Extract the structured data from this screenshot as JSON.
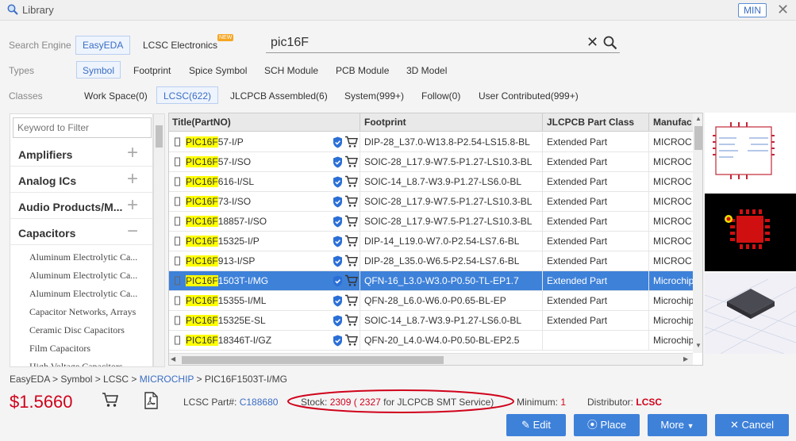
{
  "window": {
    "title": "Library",
    "min_label": "MIN"
  },
  "search_engine": {
    "label": "Search Engine",
    "options": [
      "EasyEDA",
      "LCSC Electronics"
    ],
    "new_badge": "NEW"
  },
  "search": {
    "value": "pic16F"
  },
  "types": {
    "label": "Types",
    "options": [
      "Symbol",
      "Footprint",
      "Spice Symbol",
      "SCH Module",
      "PCB Module",
      "3D Model"
    ]
  },
  "classes": {
    "label": "Classes",
    "options": [
      "Work Space(0)",
      "LCSC(622)",
      "JLCPCB Assembled(6)",
      "System(999+)",
      "Follow(0)",
      "User Contributed(999+)"
    ]
  },
  "sidebar": {
    "filter_placeholder": "Keyword to Filter",
    "categories": [
      "Amplifiers",
      "Analog ICs",
      "Audio Products/M...",
      "Capacitors"
    ],
    "subcategories": [
      "Aluminum Electrolytic Ca...",
      "Aluminum Electrolytic Ca...",
      "Aluminum Electrolytic Ca...",
      "Capacitor Networks, Arrays",
      "Ceramic Disc Capacitors",
      "Film Capacitors",
      "High Voltage Capacitors"
    ]
  },
  "table": {
    "headers": [
      "Title(PartNO)",
      "Footprint",
      "JLCPCB Part Class",
      "Manufac"
    ],
    "rows": [
      {
        "hl": "PIC16F",
        "rest": "57-I/P",
        "footprint": "DIP-28_L37.0-W13.8-P2.54-LS15.8-BL",
        "cls": "Extended Part",
        "mfr": "MICROC"
      },
      {
        "hl": "PIC16F",
        "rest": "57-I/SO",
        "footprint": "SOIC-28_L17.9-W7.5-P1.27-LS10.3-BL",
        "cls": "Extended Part",
        "mfr": "MICROC"
      },
      {
        "hl": "PIC16F",
        "rest": "616-I/SL",
        "footprint": "SOIC-14_L8.7-W3.9-P1.27-LS6.0-BL",
        "cls": "Extended Part",
        "mfr": "MICROC"
      },
      {
        "hl": "PIC16F",
        "rest": "73-I/SO",
        "footprint": "SOIC-28_L17.9-W7.5-P1.27-LS10.3-BL",
        "cls": "Extended Part",
        "mfr": "MICROC"
      },
      {
        "hl": "PIC16F",
        "rest": "18857-I/SO",
        "footprint": "SOIC-28_L17.9-W7.5-P1.27-LS10.3-BL",
        "cls": "Extended Part",
        "mfr": "MICROC"
      },
      {
        "hl": "PIC16F",
        "rest": "15325-I/P",
        "footprint": "DIP-14_L19.0-W7.0-P2.54-LS7.6-BL",
        "cls": "Extended Part",
        "mfr": "MICROC"
      },
      {
        "hl": "PIC16F",
        "rest": "913-I/SP",
        "footprint": "DIP-28_L35.0-W6.5-P2.54-LS7.6-BL",
        "cls": "Extended Part",
        "mfr": "MICROC"
      },
      {
        "hl": "PIC16F",
        "rest": "1503T-I/MG",
        "footprint": "QFN-16_L3.0-W3.0-P0.50-TL-EP1.7",
        "cls": "Extended Part",
        "mfr": "Microchip"
      },
      {
        "hl": "PIC16F",
        "rest": "15355-I/ML",
        "footprint": "QFN-28_L6.0-W6.0-P0.65-BL-EP",
        "cls": "Extended Part",
        "mfr": "Microchip"
      },
      {
        "hl": "PIC16F",
        "rest": "15325E-SL",
        "footprint": "SOIC-14_L8.7-W3.9-P1.27-LS6.0-BL",
        "cls": "Extended Part",
        "mfr": "Microchip"
      },
      {
        "hl": "PIC16F",
        "rest": "18346T-I/GZ",
        "footprint": "QFN-20_L4.0-W4.0-P0.50-BL-EP2.5",
        "cls": "",
        "mfr": "Microchip"
      }
    ]
  },
  "breadcrumb": {
    "p1": "EasyEDA > Symbol > LCSC > ",
    "mfr": "MICROCHIP",
    "p2": " > PIC16F1503T-I/MG"
  },
  "detail": {
    "price": "$1.5660",
    "lcsc_label": "LCSC Part#:",
    "lcsc_value": "C188680",
    "stock_label": "Stock:",
    "stock_value": "2309",
    "stock_paren_open": "(",
    "stock_jlc": "2327",
    "stock_suffix": "for JLCPCB SMT Service)",
    "min_label": "Minimum:",
    "min_value": "1",
    "dist_label": "Distributor:",
    "dist_value": "LCSC"
  },
  "buttons": {
    "edit": "Edit",
    "place": "Place",
    "more": "More",
    "cancel": "Cancel"
  },
  "colors": {
    "accent": "#3e81d9",
    "price": "#d0021b",
    "highlight": "#ffff00",
    "stock_circle": "#d0021b"
  }
}
